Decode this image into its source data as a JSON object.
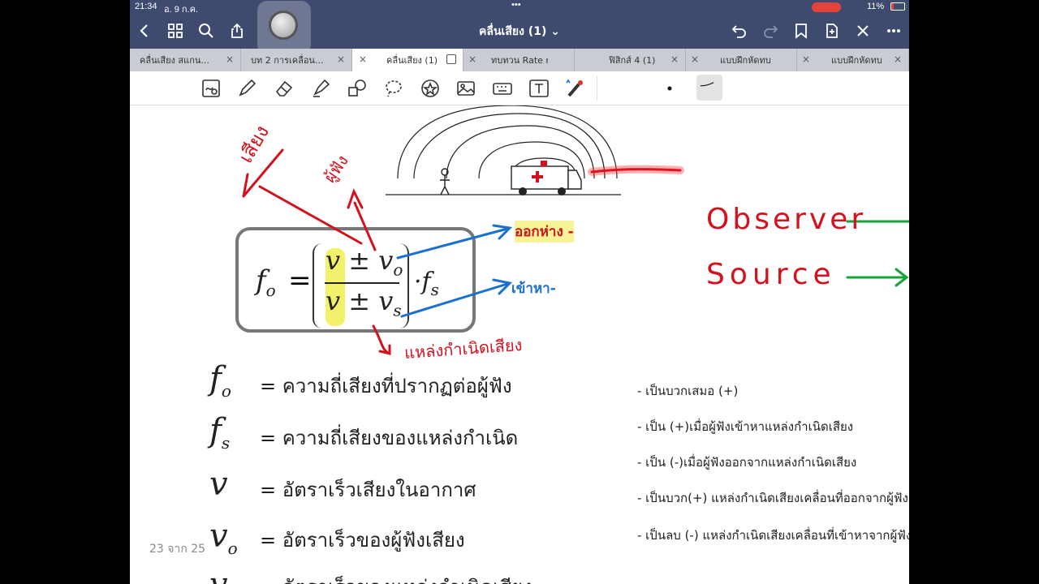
{
  "status": {
    "time": "21:34",
    "date": "อ. 9 ก.ค.",
    "dots": "•••",
    "battery": "11%"
  },
  "nav": {
    "doc_title": "คลื่นเสียง (1) ⌄"
  },
  "tabs": [
    {
      "label": "คลื่นเสียง สแกน..."
    },
    {
      "label": "บท 2 การเคลื่อน..."
    },
    {
      "label": "คลื่นเสียง (1)"
    },
    {
      "label": "ทบทวน Rate ni..."
    },
    {
      "label": "ฟิสิกส์ 4 (1)"
    },
    {
      "label": "แบบฝึกหัดทบท..."
    },
    {
      "label": "แบบฝึกหัดทบท..."
    }
  ],
  "tab_close": "×",
  "formula": {
    "lhs": "f",
    "lhs_sub": "o",
    "eq": "=",
    "num": "v ± v",
    "num_sub": "o",
    "den": "v ± v",
    "den_sub": "s",
    "rhs": "f",
    "rhs_sub": "s"
  },
  "definitions": [
    {
      "sym": "f",
      "sub": "o",
      "text": "= ความถี่เสียงที่ปรากฏต่อผู้ฟัง"
    },
    {
      "sym": "f",
      "sub": "s",
      "text": "= ความถี่เสียงของแหล่งกำเนิด"
    },
    {
      "sym": "v",
      "sub": "",
      "text": "= อัตราเร็วเสียงในอากาศ"
    },
    {
      "sym": "v",
      "sub": "o",
      "text": "= อัตราเร็วของผู้ฟังเสียง"
    },
    {
      "sym": "v",
      "sub": "",
      "text": "= อัตราเร็วของแหล่งกำเนิดเสียง"
    }
  ],
  "notes": [
    "-  เป็นบวกเสมอ (+)",
    "-  เป็น (+)เมื่อผู้ฟังเข้าหาแหล่งกำเนิดเสียง",
    "-  เป็น (-)เมื่อผู้ฟังออกจากแหล่งกำเนิดเสียง",
    "-  เป็นบวก(+) แหล่งกำเนิดเสียงเคลื่อนที่ออกจากผู้ฟัง",
    "-  เป็นลบ (-)  แหล่งกำเนิดเสียงเคลื่อนที่เข้าหาจากผู้ฟัง"
  ],
  "page_counter": "23 จาก 25",
  "handwriting": {
    "siang": "เสียง",
    "phu_fang": "ผู้ฟัง",
    "ok_hang": "ออกห่าง -",
    "khao_ha": "เข้าหา-",
    "laeng": "แหล่งกำเนิดเสียง",
    "observer": "Observer",
    "source": "Source"
  },
  "colors": {
    "toolbar": "#3f4a6f",
    "tabs": "#c9ccd3",
    "red_ink": "#d3121e",
    "blue_ink": "#1a6fd0",
    "green_ink": "#13a53a",
    "highlight": "#f3f06a"
  }
}
